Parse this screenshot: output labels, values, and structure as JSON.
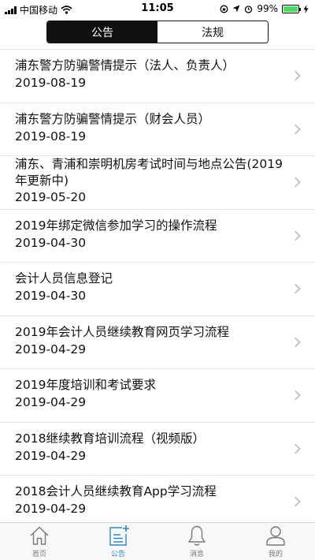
{
  "status": {
    "carrier": "中国移动",
    "time": "11:05",
    "battery": "99%",
    "battery_level": 0.99
  },
  "segments": [
    {
      "label": "公告",
      "active": true
    },
    {
      "label": "法规",
      "active": false
    }
  ],
  "notices": [
    {
      "title": "浦东警方防骗警情提示（法人、负责人）",
      "date": "2019-08-19"
    },
    {
      "title": "浦东警方防骗警情提示（财会人员）",
      "date": "2019-08-19"
    },
    {
      "title": "浦东、青浦和崇明机房考试时间与地点公告(2019年更新中)",
      "date": "2019-05-20"
    },
    {
      "title": "2019年绑定微信参加学习的操作流程",
      "date": "2019-04-30"
    },
    {
      "title": "会计人员信息登记",
      "date": "2019-04-30"
    },
    {
      "title": "2019年会计人员继续教育网页学习流程",
      "date": "2019-04-29"
    },
    {
      "title": "2019年度培训和考试要求",
      "date": "2019-04-29"
    },
    {
      "title": "2018继续教育培训流程（视频版）",
      "date": "2019-04-29"
    },
    {
      "title": "2018会计人员继续教育App学习流程",
      "date": "2019-04-29"
    }
  ],
  "tabbar": [
    {
      "label": "首页",
      "icon": "home-icon",
      "active": false
    },
    {
      "label": "公告",
      "icon": "notice-add-icon",
      "active": true
    },
    {
      "label": "消息",
      "icon": "bell-icon",
      "active": false
    },
    {
      "label": "我的",
      "icon": "person-icon",
      "active": false
    }
  ],
  "colors": {
    "accent": "#2f86c6",
    "segment_active_bg": "#111111",
    "battery_green": "#4cd964",
    "chevron": "#c4c4c8"
  }
}
